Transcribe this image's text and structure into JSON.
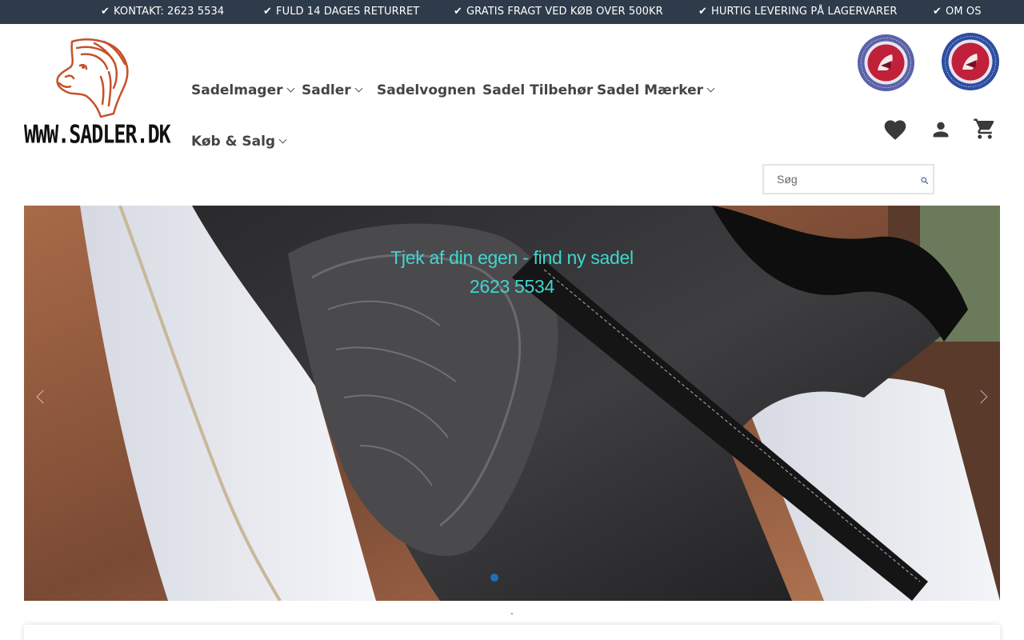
{
  "topbar": {
    "items": [
      {
        "check": "✔",
        "label": "KONTAKT: 2623 5534"
      },
      {
        "check": "✔",
        "label": "FULD 14 DAGES RETURRET"
      },
      {
        "check": "✔",
        "label": "GRATIS FRAGT VED KØB OVER 500KR"
      },
      {
        "check": "✔",
        "label": "HURTIG LEVERING PÅ LAGERVARER"
      },
      {
        "check": "✔",
        "label": "OM OS"
      }
    ],
    "background": "#2e3b4a"
  },
  "logo": {
    "text": "WWW.SADLER.DK",
    "color": "#c5522a"
  },
  "nav": {
    "items": [
      {
        "label": "Sadelmager",
        "has_dropdown": true
      },
      {
        "label": "Sadler",
        "has_dropdown": true
      },
      {
        "label": "Sadelvognen",
        "has_dropdown": false
      },
      {
        "label": "Sadel Tilbehør",
        "has_dropdown": false
      },
      {
        "label": "Sadel Mærker",
        "has_dropdown": true
      },
      {
        "label": "Køb & Salg",
        "has_dropdown": true
      }
    ]
  },
  "badges": [
    {
      "name": "approved-retailer-badge",
      "icon": "society-of-master-saddlers-badge"
    },
    {
      "name": "overseas-member-badge",
      "icon": "society-of-master-saddlers-badge"
    }
  ],
  "header_icons": [
    "heart-icon",
    "user-icon",
    "cart-icon"
  ],
  "search": {
    "placeholder": "Søg",
    "value": ""
  },
  "hero": {
    "line1": "Tjek af din egen - find ny sadel",
    "line2": "2623 5534",
    "text_color": "#3fd6cf",
    "active_slide": 1
  },
  "below_hero": {
    "text": "-"
  }
}
